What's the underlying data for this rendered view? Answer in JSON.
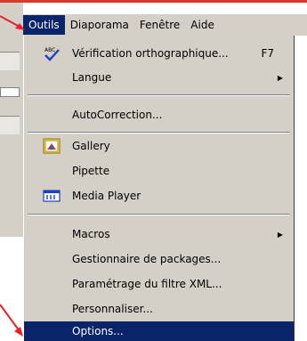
{
  "menubar": {
    "items": [
      {
        "label": "Outils",
        "active": true
      },
      {
        "label": "Diaporama"
      },
      {
        "label": "Fenêtre"
      },
      {
        "label": "Aide"
      }
    ]
  },
  "menu": {
    "items": [
      {
        "label": "Vérification orthographique...",
        "shortcut": "F7",
        "icon": "spellcheck-icon"
      },
      {
        "label": "Langue",
        "submenu": true
      },
      {
        "label": "AutoCorrection..."
      },
      {
        "label": "Gallery",
        "icon": "gallery-icon"
      },
      {
        "label": "Pipette"
      },
      {
        "label": "Media Player",
        "icon": "media-player-icon"
      },
      {
        "label": "Macros",
        "submenu": true
      },
      {
        "label": "Gestionnaire de packages..."
      },
      {
        "label": "Paramétrage du filtre XML..."
      },
      {
        "label": "Personnaliser..."
      },
      {
        "label": "Options...",
        "highlighted": true
      }
    ]
  },
  "colors": {
    "highlight": "#0a246a",
    "menu_bg": "#d4d0c8",
    "annotation_arrow": "#e8202a"
  }
}
